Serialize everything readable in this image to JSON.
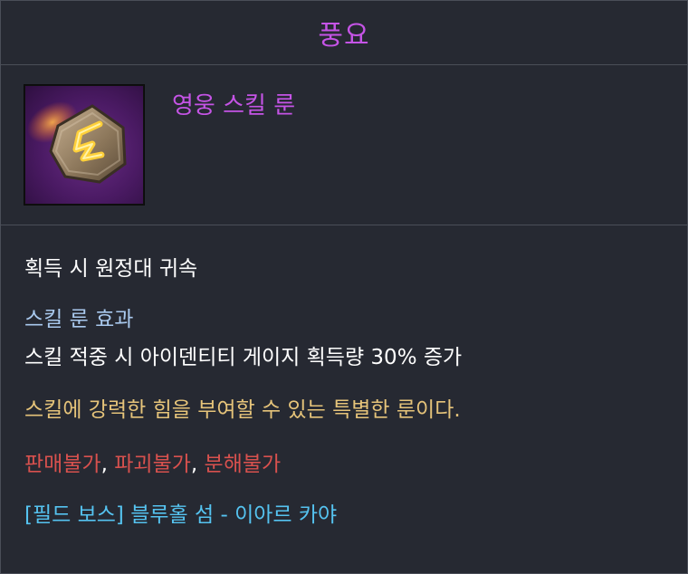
{
  "tooltip": {
    "title": "풍요",
    "item_type": "영웅 스킬 룬",
    "icon": "rune-stone-icon",
    "bound": "획득 시 원정대 귀속",
    "effect_title": "스킬 룬 효과",
    "effect_desc": "스킬 적중 시 아이덴티티 게이지 획득량 30% 증가",
    "flavor": "스킬에 강력한 힘을 부여할 수 있는 특별한 룬이다.",
    "restrictions": [
      "판매불가",
      "파괴불가",
      "분해불가"
    ],
    "separator": ",",
    "source": "[필드 보스] 블루홀 섬 - 이아르 카야"
  },
  "colors": {
    "background": "#262932",
    "title": "#c554e6",
    "effect_title": "#a9c9ee",
    "flavor": "#e6c47a",
    "restriction": "#d8514e",
    "source": "#55c3f0"
  }
}
